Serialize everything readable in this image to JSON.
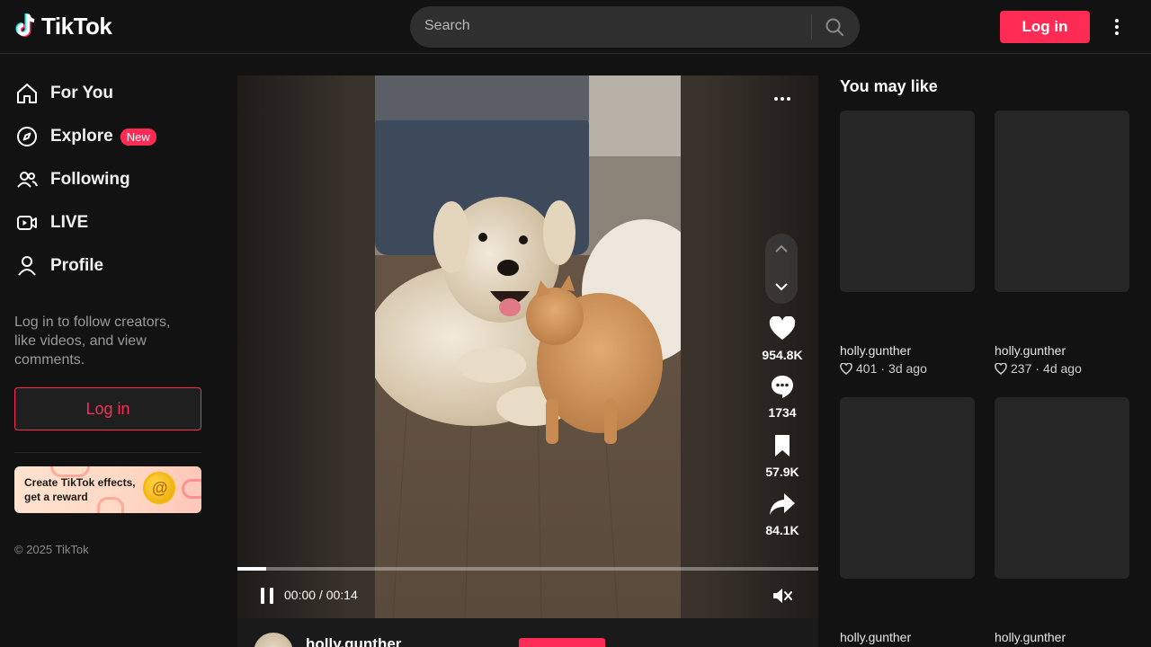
{
  "header": {
    "logo_text": "TikTok",
    "search_placeholder": "Search",
    "login_label": "Log in"
  },
  "sidebar": {
    "items": [
      {
        "label": "For You",
        "icon": "home-icon"
      },
      {
        "label": "Explore",
        "icon": "compass-icon",
        "badge": "New"
      },
      {
        "label": "Following",
        "icon": "users-icon"
      },
      {
        "label": "LIVE",
        "icon": "live-icon"
      },
      {
        "label": "Profile",
        "icon": "profile-icon"
      }
    ],
    "note": "Log in to follow creators, like videos, and view comments.",
    "login_label": "Log in",
    "banner_text": "Create TikTok effects, get a reward",
    "copyright": "© 2025 TikTok"
  },
  "video": {
    "actions": [
      {
        "name": "like",
        "count": "954.8K",
        "icon": "heart-icon"
      },
      {
        "name": "comment",
        "count": "1734",
        "icon": "comment-icon"
      },
      {
        "name": "save",
        "count": "57.9K",
        "icon": "bookmark-icon"
      },
      {
        "name": "share",
        "count": "84.1K",
        "icon": "share-icon"
      }
    ],
    "time": "00:00 / 00:14",
    "progress": 0.05,
    "author": "holly.gunther"
  },
  "right": {
    "title": "You may like",
    "cards": [
      {
        "author": "holly.gunther",
        "likes": "401",
        "age": "3d ago"
      },
      {
        "author": "holly.gunther",
        "likes": "237",
        "age": "4d ago"
      },
      {
        "author": "holly.gunther"
      },
      {
        "author": "holly.gunther"
      }
    ]
  },
  "colors": {
    "accent": "#fe2c55",
    "background": "#121212"
  }
}
